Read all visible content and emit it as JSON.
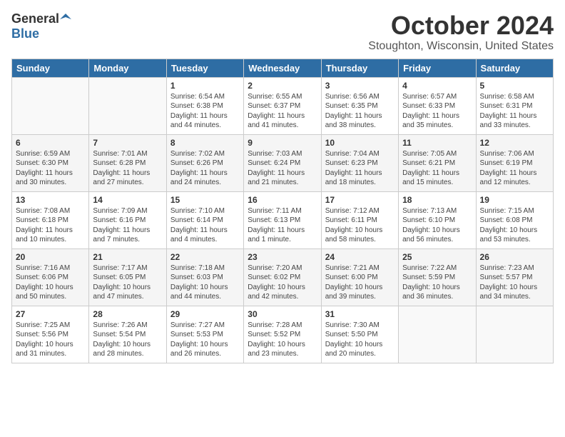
{
  "logo": {
    "general": "General",
    "blue": "Blue"
  },
  "title": "October 2024",
  "location": "Stoughton, Wisconsin, United States",
  "days_header": [
    "Sunday",
    "Monday",
    "Tuesday",
    "Wednesday",
    "Thursday",
    "Friday",
    "Saturday"
  ],
  "weeks": [
    [
      {
        "day": "",
        "sunrise": "",
        "sunset": "",
        "daylight": ""
      },
      {
        "day": "",
        "sunrise": "",
        "sunset": "",
        "daylight": ""
      },
      {
        "day": "1",
        "sunrise": "Sunrise: 6:54 AM",
        "sunset": "Sunset: 6:38 PM",
        "daylight": "Daylight: 11 hours and 44 minutes."
      },
      {
        "day": "2",
        "sunrise": "Sunrise: 6:55 AM",
        "sunset": "Sunset: 6:37 PM",
        "daylight": "Daylight: 11 hours and 41 minutes."
      },
      {
        "day": "3",
        "sunrise": "Sunrise: 6:56 AM",
        "sunset": "Sunset: 6:35 PM",
        "daylight": "Daylight: 11 hours and 38 minutes."
      },
      {
        "day": "4",
        "sunrise": "Sunrise: 6:57 AM",
        "sunset": "Sunset: 6:33 PM",
        "daylight": "Daylight: 11 hours and 35 minutes."
      },
      {
        "day": "5",
        "sunrise": "Sunrise: 6:58 AM",
        "sunset": "Sunset: 6:31 PM",
        "daylight": "Daylight: 11 hours and 33 minutes."
      }
    ],
    [
      {
        "day": "6",
        "sunrise": "Sunrise: 6:59 AM",
        "sunset": "Sunset: 6:30 PM",
        "daylight": "Daylight: 11 hours and 30 minutes."
      },
      {
        "day": "7",
        "sunrise": "Sunrise: 7:01 AM",
        "sunset": "Sunset: 6:28 PM",
        "daylight": "Daylight: 11 hours and 27 minutes."
      },
      {
        "day": "8",
        "sunrise": "Sunrise: 7:02 AM",
        "sunset": "Sunset: 6:26 PM",
        "daylight": "Daylight: 11 hours and 24 minutes."
      },
      {
        "day": "9",
        "sunrise": "Sunrise: 7:03 AM",
        "sunset": "Sunset: 6:24 PM",
        "daylight": "Daylight: 11 hours and 21 minutes."
      },
      {
        "day": "10",
        "sunrise": "Sunrise: 7:04 AM",
        "sunset": "Sunset: 6:23 PM",
        "daylight": "Daylight: 11 hours and 18 minutes."
      },
      {
        "day": "11",
        "sunrise": "Sunrise: 7:05 AM",
        "sunset": "Sunset: 6:21 PM",
        "daylight": "Daylight: 11 hours and 15 minutes."
      },
      {
        "day": "12",
        "sunrise": "Sunrise: 7:06 AM",
        "sunset": "Sunset: 6:19 PM",
        "daylight": "Daylight: 11 hours and 12 minutes."
      }
    ],
    [
      {
        "day": "13",
        "sunrise": "Sunrise: 7:08 AM",
        "sunset": "Sunset: 6:18 PM",
        "daylight": "Daylight: 11 hours and 10 minutes."
      },
      {
        "day": "14",
        "sunrise": "Sunrise: 7:09 AM",
        "sunset": "Sunset: 6:16 PM",
        "daylight": "Daylight: 11 hours and 7 minutes."
      },
      {
        "day": "15",
        "sunrise": "Sunrise: 7:10 AM",
        "sunset": "Sunset: 6:14 PM",
        "daylight": "Daylight: 11 hours and 4 minutes."
      },
      {
        "day": "16",
        "sunrise": "Sunrise: 7:11 AM",
        "sunset": "Sunset: 6:13 PM",
        "daylight": "Daylight: 11 hours and 1 minute."
      },
      {
        "day": "17",
        "sunrise": "Sunrise: 7:12 AM",
        "sunset": "Sunset: 6:11 PM",
        "daylight": "Daylight: 10 hours and 58 minutes."
      },
      {
        "day": "18",
        "sunrise": "Sunrise: 7:13 AM",
        "sunset": "Sunset: 6:10 PM",
        "daylight": "Daylight: 10 hours and 56 minutes."
      },
      {
        "day": "19",
        "sunrise": "Sunrise: 7:15 AM",
        "sunset": "Sunset: 6:08 PM",
        "daylight": "Daylight: 10 hours and 53 minutes."
      }
    ],
    [
      {
        "day": "20",
        "sunrise": "Sunrise: 7:16 AM",
        "sunset": "Sunset: 6:06 PM",
        "daylight": "Daylight: 10 hours and 50 minutes."
      },
      {
        "day": "21",
        "sunrise": "Sunrise: 7:17 AM",
        "sunset": "Sunset: 6:05 PM",
        "daylight": "Daylight: 10 hours and 47 minutes."
      },
      {
        "day": "22",
        "sunrise": "Sunrise: 7:18 AM",
        "sunset": "Sunset: 6:03 PM",
        "daylight": "Daylight: 10 hours and 44 minutes."
      },
      {
        "day": "23",
        "sunrise": "Sunrise: 7:20 AM",
        "sunset": "Sunset: 6:02 PM",
        "daylight": "Daylight: 10 hours and 42 minutes."
      },
      {
        "day": "24",
        "sunrise": "Sunrise: 7:21 AM",
        "sunset": "Sunset: 6:00 PM",
        "daylight": "Daylight: 10 hours and 39 minutes."
      },
      {
        "day": "25",
        "sunrise": "Sunrise: 7:22 AM",
        "sunset": "Sunset: 5:59 PM",
        "daylight": "Daylight: 10 hours and 36 minutes."
      },
      {
        "day": "26",
        "sunrise": "Sunrise: 7:23 AM",
        "sunset": "Sunset: 5:57 PM",
        "daylight": "Daylight: 10 hours and 34 minutes."
      }
    ],
    [
      {
        "day": "27",
        "sunrise": "Sunrise: 7:25 AM",
        "sunset": "Sunset: 5:56 PM",
        "daylight": "Daylight: 10 hours and 31 minutes."
      },
      {
        "day": "28",
        "sunrise": "Sunrise: 7:26 AM",
        "sunset": "Sunset: 5:54 PM",
        "daylight": "Daylight: 10 hours and 28 minutes."
      },
      {
        "day": "29",
        "sunrise": "Sunrise: 7:27 AM",
        "sunset": "Sunset: 5:53 PM",
        "daylight": "Daylight: 10 hours and 26 minutes."
      },
      {
        "day": "30",
        "sunrise": "Sunrise: 7:28 AM",
        "sunset": "Sunset: 5:52 PM",
        "daylight": "Daylight: 10 hours and 23 minutes."
      },
      {
        "day": "31",
        "sunrise": "Sunrise: 7:30 AM",
        "sunset": "Sunset: 5:50 PM",
        "daylight": "Daylight: 10 hours and 20 minutes."
      },
      {
        "day": "",
        "sunrise": "",
        "sunset": "",
        "daylight": ""
      },
      {
        "day": "",
        "sunrise": "",
        "sunset": "",
        "daylight": ""
      }
    ]
  ]
}
